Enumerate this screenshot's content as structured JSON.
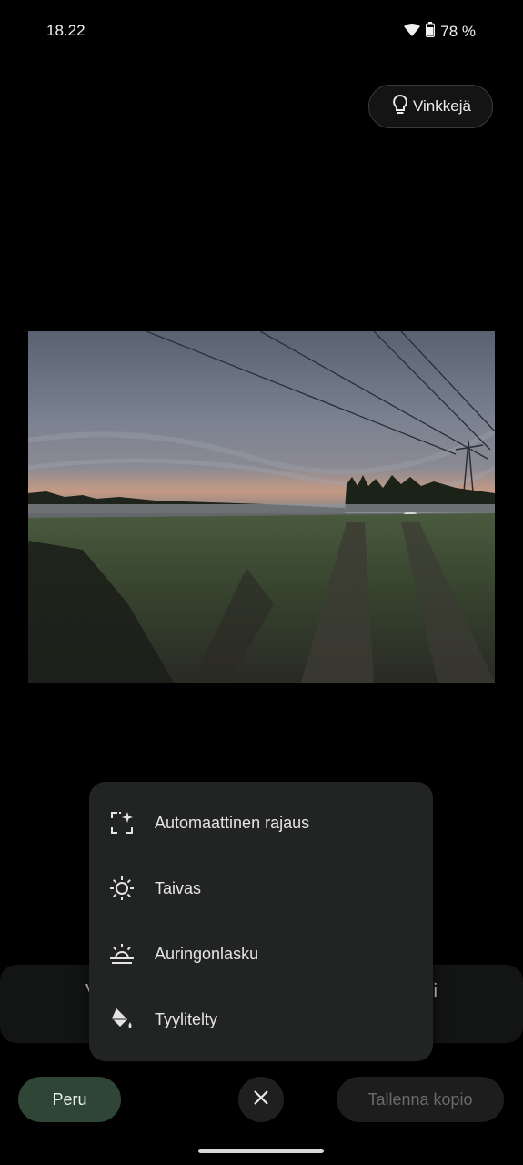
{
  "status_bar": {
    "time": "18.22",
    "battery": "78 %"
  },
  "tips_button": {
    "label": "Vinkkejä"
  },
  "photo": {
    "description_icon": "landscape-photo"
  },
  "behind_bar": {
    "left_partial": "V",
    "right_partial": "i"
  },
  "menu": {
    "items": [
      {
        "label": "Automaattinen rajaus",
        "icon": "auto-crop-icon"
      },
      {
        "label": "Taivas",
        "icon": "sun-icon"
      },
      {
        "label": "Auringonlasku",
        "icon": "sunset-icon"
      },
      {
        "label": "Tyylitelty",
        "icon": "paint-bucket-icon"
      }
    ]
  },
  "bottom_bar": {
    "cancel_label": "Peru",
    "save_copy_label": "Tallenna kopio"
  },
  "colors": {
    "accent": "#2f4536",
    "menu_bg": "#222423"
  }
}
